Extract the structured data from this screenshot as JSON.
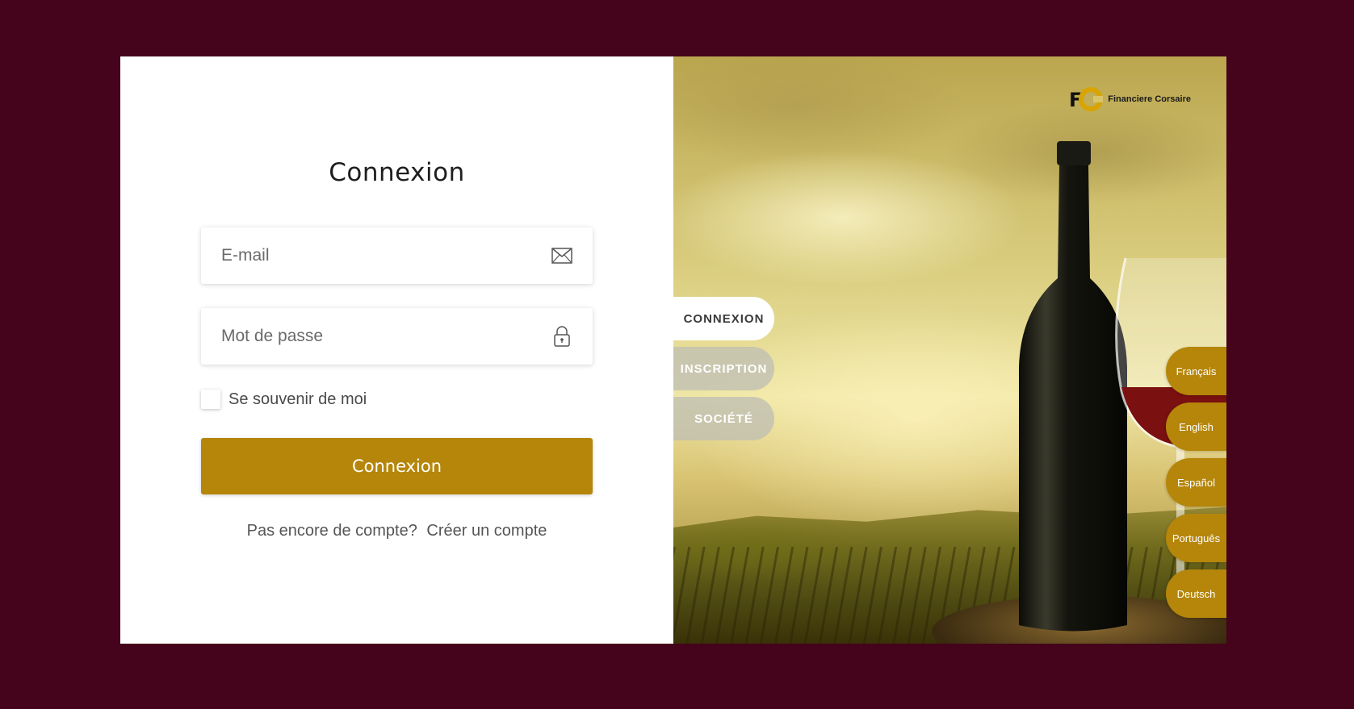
{
  "login": {
    "title": "Connexion",
    "email_placeholder": "E-mail",
    "password_placeholder": "Mot de passe",
    "remember_label": "Se souvenir de moi",
    "submit_label": "Connexion",
    "no_account_text": "Pas encore de compte?",
    "create_account_link": "Créer un compte"
  },
  "brand": {
    "name": "Financiere Corsaire",
    "logo_letters": "FC",
    "accent_color": "#b5860a",
    "background_color": "#46041c"
  },
  "tabs": [
    {
      "label": "CONNEXION",
      "active": true
    },
    {
      "label": "INSCRIPTION",
      "active": false
    },
    {
      "label": "SOCIÉTÉ",
      "active": false
    }
  ],
  "languages": [
    "Français",
    "English",
    "Español",
    "Português",
    "Deutsch"
  ],
  "icons": {
    "email": "envelope-icon",
    "password": "lock-icon"
  }
}
